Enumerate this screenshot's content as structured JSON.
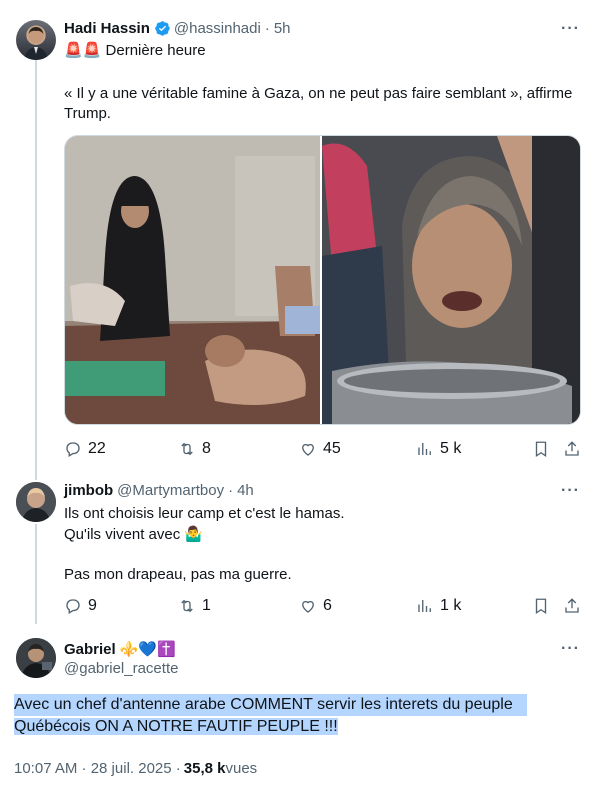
{
  "tweet1": {
    "name": "Hadi Hassin",
    "handle": "@hassinhadi",
    "time": "5h",
    "emoji_prefix": "🚨🚨",
    "line1": "Dernière heure",
    "quote": "« Il y a une véritable famine à Gaza, on ne peut pas faire semblant », affirme Trump.",
    "stats": {
      "replies": "22",
      "retweets": "8",
      "likes": "45",
      "views": "5 k"
    }
  },
  "tweet2": {
    "name": "jimbob",
    "handle": "@Martymartboy",
    "time": "4h",
    "line1": "Ils ont choisis leur camp et c'est le hamas.",
    "line2": "Qu'ils vivent avec 🤷‍♂️",
    "line3": "Pas mon drapeau, pas ma guerre.",
    "stats": {
      "replies": "9",
      "retweets": "1",
      "likes": "6",
      "views": "1 k"
    }
  },
  "tweet3": {
    "name": "Gabriel",
    "name_emoji": "⚜️💙✝️",
    "handle": "@gabriel_racette",
    "line1": "Avec un chef d'antenne arabe COMMENT servir les interets du peuple",
    "line2": "Québécois ON A NOTRE FAUTIF PEUPLE !!!",
    "timestamp": "10:07 AM · 28 juil. 2025 · ",
    "views": "35,8 k",
    "views_label": " vues"
  },
  "icons": [
    "verified-icon",
    "more-icon",
    "reply-icon",
    "retweet-icon",
    "like-icon",
    "views-icon",
    "bookmark-icon",
    "share-icon"
  ],
  "colors": {
    "text": "#0f1419",
    "muted": "#536471",
    "verified": "#1d9bf0",
    "selection": "#b4d5fe",
    "line": "#cfd9de"
  }
}
